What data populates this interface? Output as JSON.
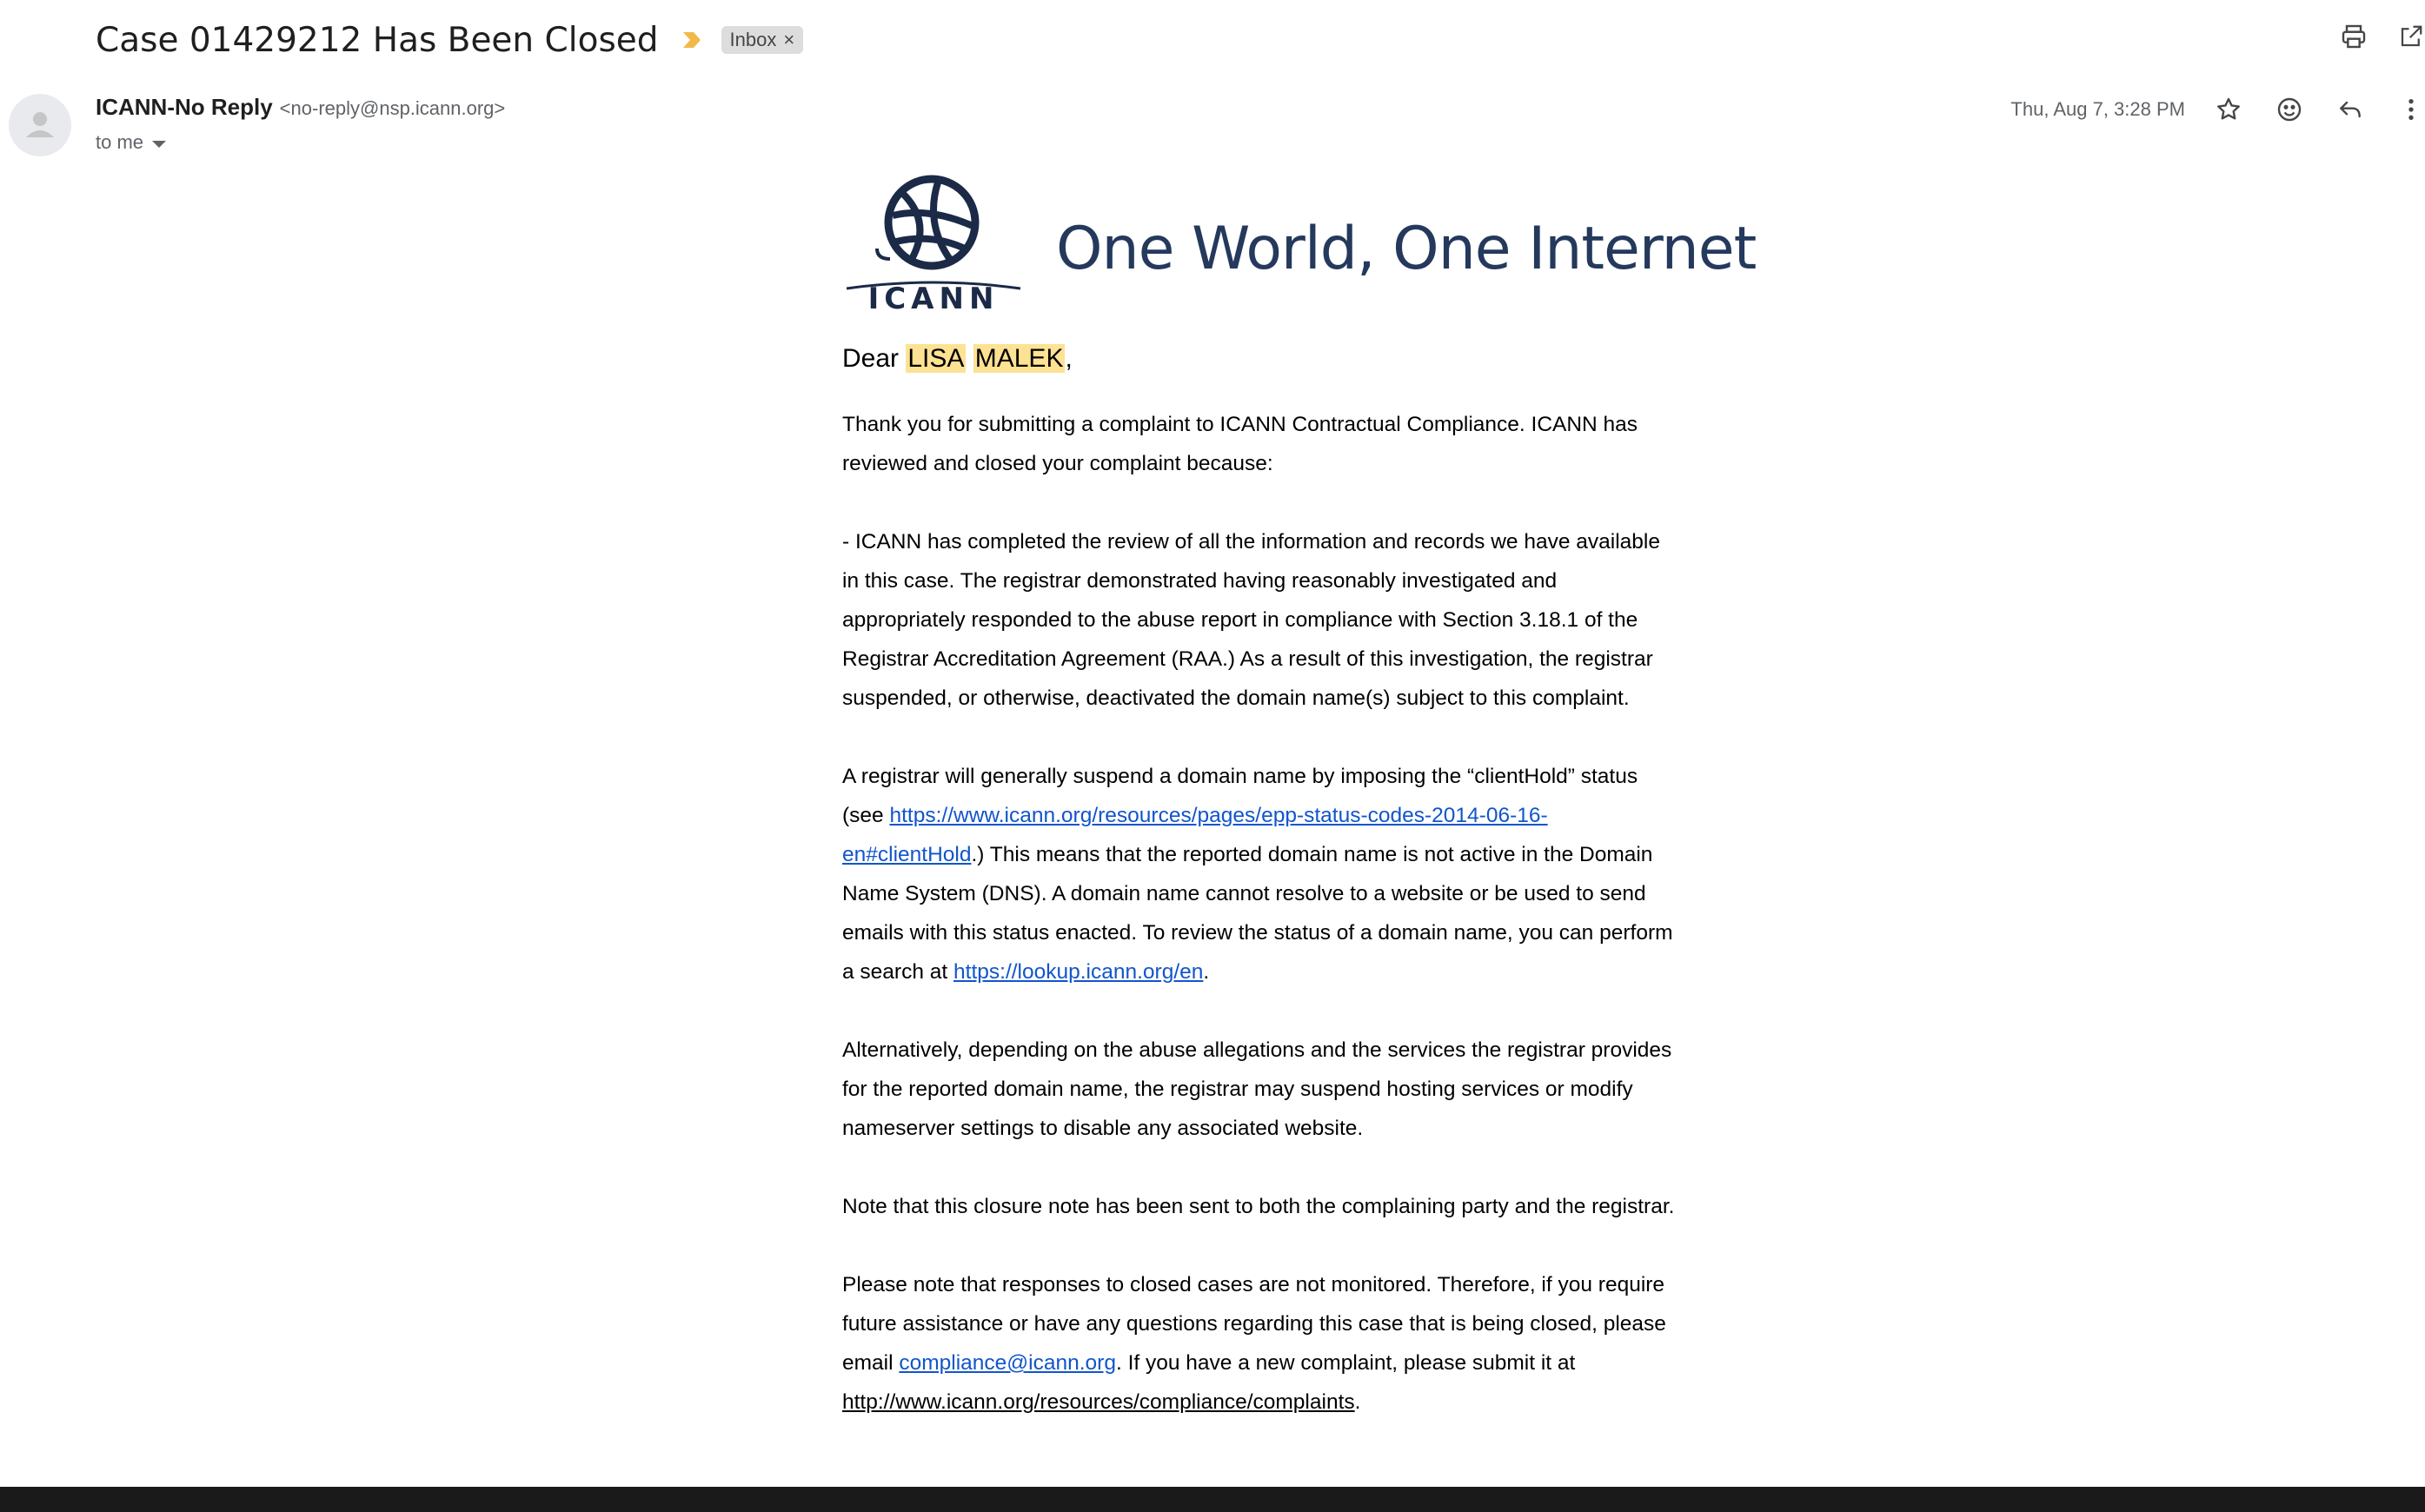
{
  "header": {
    "subject": "Case 01429212 Has Been Closed",
    "label": "Inbox",
    "label_remove": "×",
    "importance_color": "#f2b94a",
    "icons": [
      "print-icon",
      "open-in-new-window-icon"
    ]
  },
  "message": {
    "sender_name": "ICANN-No Reply",
    "sender_email": "<no-reply@nsp.icann.org>",
    "to_line": "to me",
    "date": "Thu, Aug 7, 3:28 PM",
    "action_icons": [
      "star-icon",
      "emoji-reaction-icon",
      "reply-icon",
      "more-options-icon"
    ]
  },
  "body": {
    "logo_text": "ICANN",
    "tagline": "One World, One Internet",
    "greeting_prefix": "Dear ",
    "first_name": "LISA",
    "last_name": "MALEK",
    "greeting_suffix": ",",
    "p1": "Thank you for submitting a complaint to ICANN Contractual Compliance. ICANN has reviewed and closed your complaint because:",
    "p2": "- ICANN has completed the review of all the information and records we have available in this case. The registrar demonstrated having reasonably investigated and appropriately responded to the abuse report in compliance with Section 3.18.1 of the Registrar Accreditation Agreement (RAA.) As a result of this investigation, the registrar suspended, or otherwise, deactivated the domain name(s) subject to this complaint.",
    "p3_a": "A registrar will generally suspend a domain name by imposing the “clientHold” status (see ",
    "p3_link1": "https://www.icann.org/resources/pages/epp-status-codes-2014-06-16-en#clientHold",
    "p3_b": ".) This means that the reported domain name is not active in the Domain Name System (DNS). A domain name cannot resolve to a website or be used to send emails with this status enacted. To review the status of a domain name, you can perform a search at ",
    "p3_link2": "https://lookup.icann.org/en",
    "p3_c": ".",
    "p4": "Alternatively, depending on the abuse allegations and the services the registrar provides for the reported domain name, the registrar may suspend hosting services or modify nameserver settings to disable any associated website.",
    "p5": "Note that this closure note has been sent to both the complaining party and the registrar.",
    "p6_a": "Please note that responses to closed cases are not monitored. Therefore, if you require future assistance or have any questions regarding this case that is being closed, please email ",
    "p6_link1": "compliance@icann.org",
    "p6_b": ". If you have a new complaint, please submit it at ",
    "p6_link2": "http://www.icann.org/resources/compliance/complaints",
    "p6_c": "."
  }
}
